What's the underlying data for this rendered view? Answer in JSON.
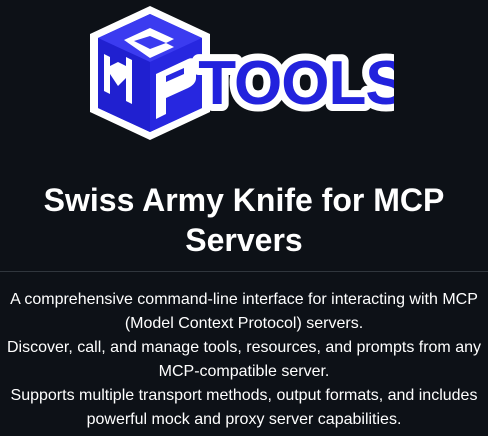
{
  "logo": {
    "mark_letters": "MCP",
    "wordmark": "TOOLS",
    "colors": {
      "brand_blue": "#2222dd",
      "outline": "#ffffff",
      "shadow": "#0d1117"
    }
  },
  "header": {
    "title": "Swiss Army Knife for MCP Servers"
  },
  "description": {
    "lines": [
      "A comprehensive command-line interface for interacting with MCP (Model Context Protocol) servers.",
      "Discover, call, and manage tools, resources, and prompts from any MCP-compatible server.",
      "Supports multiple transport methods, output formats, and includes powerful mock and proxy server capabilities."
    ]
  },
  "theme": {
    "background": "#0d1117",
    "text": "#ffffff",
    "divider": "#30363d"
  }
}
